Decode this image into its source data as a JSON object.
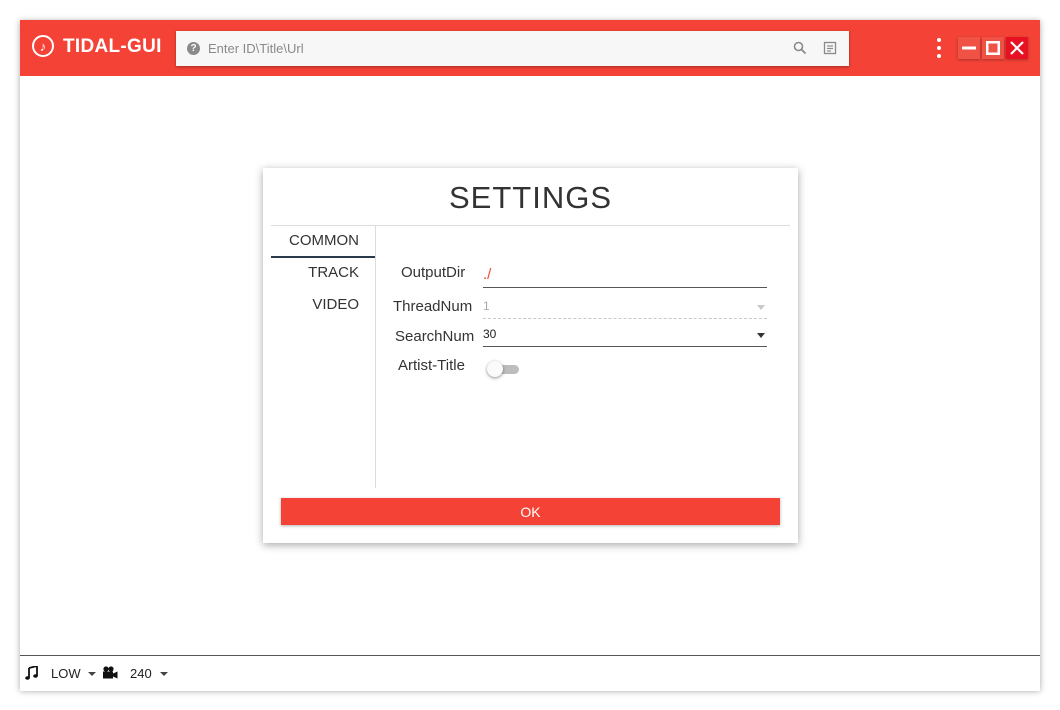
{
  "app": {
    "title": "TIDAL-GUI"
  },
  "search": {
    "placeholder": "Enter ID\\Title\\Url",
    "value": ""
  },
  "settings": {
    "title": "SETTINGS",
    "tabs": [
      {
        "label": "COMMON",
        "active": true
      },
      {
        "label": "TRACK",
        "active": false
      },
      {
        "label": "VIDEO",
        "active": false
      }
    ],
    "fields": {
      "output_dir": {
        "label": "OutputDir",
        "value": "./"
      },
      "thread_num": {
        "label": "ThreadNum",
        "value": "1",
        "disabled": true
      },
      "search_num": {
        "label": "SearchNum",
        "value": "30"
      },
      "artist_title": {
        "label": "Artist-Title",
        "on": false
      }
    },
    "ok_label": "OK"
  },
  "status": {
    "audio_quality": "LOW",
    "video_quality": "240"
  },
  "colors": {
    "accent": "#f44336",
    "close": "#e81123"
  },
  "icons": [
    "music-note-icon",
    "help-icon",
    "search-icon",
    "list-icon",
    "more-vert-icon",
    "minimize-icon",
    "maximize-icon",
    "close-icon",
    "video-camera-icon"
  ]
}
